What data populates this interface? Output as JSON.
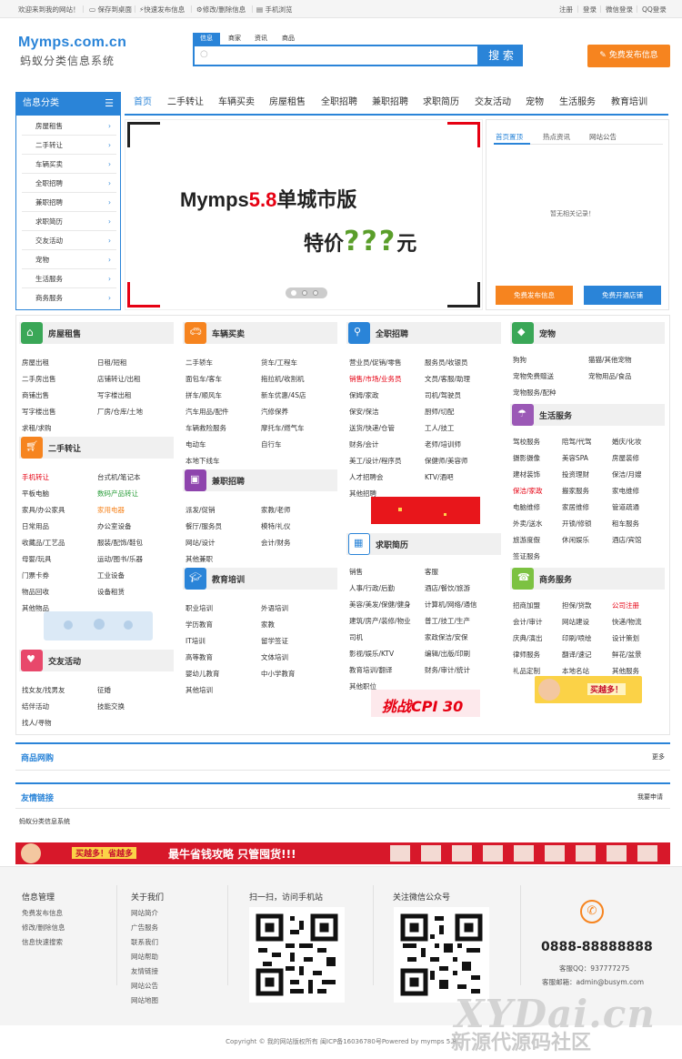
{
  "topbar": {
    "welcome": "欢迎来到我的网站！",
    "save_desktop": "保存到桌面",
    "quick_post": "快速发布信息",
    "edit_delete": "修改/删除信息",
    "mobile": "手机浏览",
    "register": "注册",
    "login": "登录",
    "wechat_login": "微信登录",
    "qq_login": "QQ登录"
  },
  "header": {
    "logo_main": "Mymps.com.cn",
    "logo_sub": "蚂蚁分类信息系统",
    "search_tabs": [
      "信息",
      "商家",
      "资讯",
      "商品"
    ],
    "search_button": "搜 索",
    "post_button": "免费发布信息"
  },
  "sidebar": {
    "title": "信息分类",
    "items": [
      "房屋租售",
      "二手转让",
      "车辆买卖",
      "全职招聘",
      "兼职招聘",
      "求职简历",
      "交友活动",
      "宠物",
      "生活服务",
      "商务服务"
    ]
  },
  "nav": {
    "items": [
      "首页",
      "二手转让",
      "车辆买卖",
      "房屋租售",
      "全职招聘",
      "兼职招聘",
      "求职简历",
      "交友活动",
      "宠物",
      "生活服务",
      "教育培训"
    ]
  },
  "banner": {
    "line1_a": "Mymps",
    "line1_b": "5.8",
    "line1_c": "单城市版",
    "line2_a": "特价",
    "line2_b": "???",
    "line2_c": "元"
  },
  "newsbox": {
    "tabs": [
      "首页置顶",
      "热点资讯",
      "网站公告"
    ],
    "empty": "暂无相关记录！",
    "btn_post": "免费发布信息",
    "btn_shop": "免费开通店铺"
  },
  "categories": {
    "house": {
      "title": "房屋租售",
      "items": [
        "房屋出租",
        "日租/短租",
        "二手房出售",
        "店铺转让/出租",
        "商铺出售",
        "写字楼出租",
        "写字楼出售",
        "厂房/仓库/土地",
        "求租/求购"
      ]
    },
    "secondhand": {
      "title": "二手转让",
      "items": [
        "手机转让",
        "台式机/笔记本",
        "平板电脑",
        "数码产品转让",
        "家具/办公家具",
        "家用电器",
        "日常用品",
        "办公室设备",
        "收藏品/工艺品",
        "服装/配饰/鞋包",
        "母婴/玩具",
        "运动/图书/乐器",
        "门票卡券",
        "工业设备",
        "物品回收",
        "设备租赁",
        "其他物品"
      ]
    },
    "dating": {
      "title": "交友活动",
      "items": [
        "找女友/找男友",
        "征婚",
        "结伴活动",
        "技能交换",
        "找人/寻物"
      ]
    },
    "cars": {
      "title": "车辆买卖",
      "items": [
        "二手轿车",
        "货车/工程车",
        "面包车/客车",
        "拖拉机/收割机",
        "拼车/顺风车",
        "新车优惠/4S店",
        "汽车用品/配件",
        "汽修保养",
        "车辆救险服务",
        "摩托车/燃气车",
        "电动车",
        "自行车",
        "本地下线车"
      ]
    },
    "parttime": {
      "title": "兼职招聘",
      "items": [
        "派发/促销",
        "家教/老师",
        "餐厅/服务员",
        "模特/礼仪",
        "网站/设计",
        "会计/财务",
        "其他兼职"
      ]
    },
    "education": {
      "title": "教育培训",
      "items": [
        "职业培训",
        "外语培训",
        "学历教育",
        "家教",
        "IT培训",
        "留学签证",
        "高等教育",
        "文体培训",
        "婴幼儿教育",
        "中小学教育",
        "其他培训"
      ]
    },
    "fulltime": {
      "title": "全职招聘",
      "items": [
        "营业员/促销/零售",
        "服务员/收银员",
        "销售/市场/业务员",
        "文员/客服/助理",
        "保姆/家政",
        "司机/驾驶员",
        "保安/保洁",
        "厨师/切配",
        "送货/快递/仓管",
        "工人/技工",
        "财务/会计",
        "老师/培训师",
        "美工/设计/程序员",
        "保健师/美容师",
        "人才招聘会",
        "KTV/酒吧",
        "其他招聘"
      ]
    },
    "resume": {
      "title": "求职简历",
      "items": [
        "销售",
        "客服",
        "人事/行政/后勤",
        "酒店/餐饮/旅游",
        "美容/美发/保健/健身",
        "计算机/网络/通信",
        "建筑/房产/装修/物业",
        "普工/技工/生产",
        "司机",
        "家政保洁/安保",
        "影视/娱乐/KTV",
        "编辑/出版/印刷",
        "教育培训/翻译",
        "财务/审计/统计",
        "其他职位"
      ]
    },
    "pets": {
      "title": "宠物",
      "items": [
        "狗狗",
        "猫猫/其他宠物",
        "宠物免费赠送",
        "宠物用品/食品",
        "宠物服务/配种"
      ]
    },
    "life": {
      "title": "生活服务",
      "items": [
        "驾校服务",
        "陪驾/代驾",
        "婚庆/化妆",
        "摄影摄像",
        "美容SPA",
        "房屋装修",
        "建材装饰",
        "投资理财",
        "保洁/月嫂",
        "保洁/家政",
        "搬家服务",
        "家电维修",
        "电脑维修",
        "家居维修",
        "管道疏通",
        "外卖/送水",
        "开锁/修锁",
        "租车服务",
        "旅游度假",
        "休闲娱乐",
        "酒店/宾馆",
        "签证服务"
      ]
    },
    "business": {
      "title": "商务服务",
      "items": [
        "招商加盟",
        "担保/贷款",
        "公司注册",
        "会计/审计",
        "网站建设",
        "快递/物流",
        "庆典/演出",
        "印刷/喷绘",
        "设计策划",
        "律师服务",
        "翻译/速记",
        "鲜花/盆景",
        "礼品定制",
        "本地名站",
        "其他服务"
      ]
    }
  },
  "ads": {
    "cpi": "挑战CPI 30",
    "buy_more": "买越多！",
    "long_ad": "最牛省钱攻略 只管囤货!!!",
    "long_ad_left": "买越多！省越多"
  },
  "sections": {
    "shop": "商品网购",
    "shop_more": "更多",
    "links": "友情链接",
    "links_apply": "我要申请",
    "links_item": "蚂蚁分类信息系统"
  },
  "footer": {
    "col1_title": "信息管理",
    "col1_items": [
      "免费发布信息",
      "修改/删除信息",
      "信息快速搜索"
    ],
    "col2_title": "关于我们",
    "col2_items": [
      "网站简介",
      "广告服务",
      "联系我们",
      "网站帮助",
      "友情链接",
      "网站公告",
      "网站地图"
    ],
    "qr1_title": "扫一扫，访问手机站",
    "qr2_title": "关注微信公众号",
    "phone": "0888-88888888",
    "qq": "客服QQ：937777275",
    "email": "客服邮箱：admin@busym.com",
    "copyright": "Copyright © 我的网站版权所有 闽ICP备16036780号Powered by mymps 5.8",
    "watermark1": "XYDai.cn",
    "watermark2": "新源代源码社区"
  },
  "colors": {
    "accent": "#2a84d8",
    "orange": "#f6841f",
    "red": "#e60012"
  }
}
